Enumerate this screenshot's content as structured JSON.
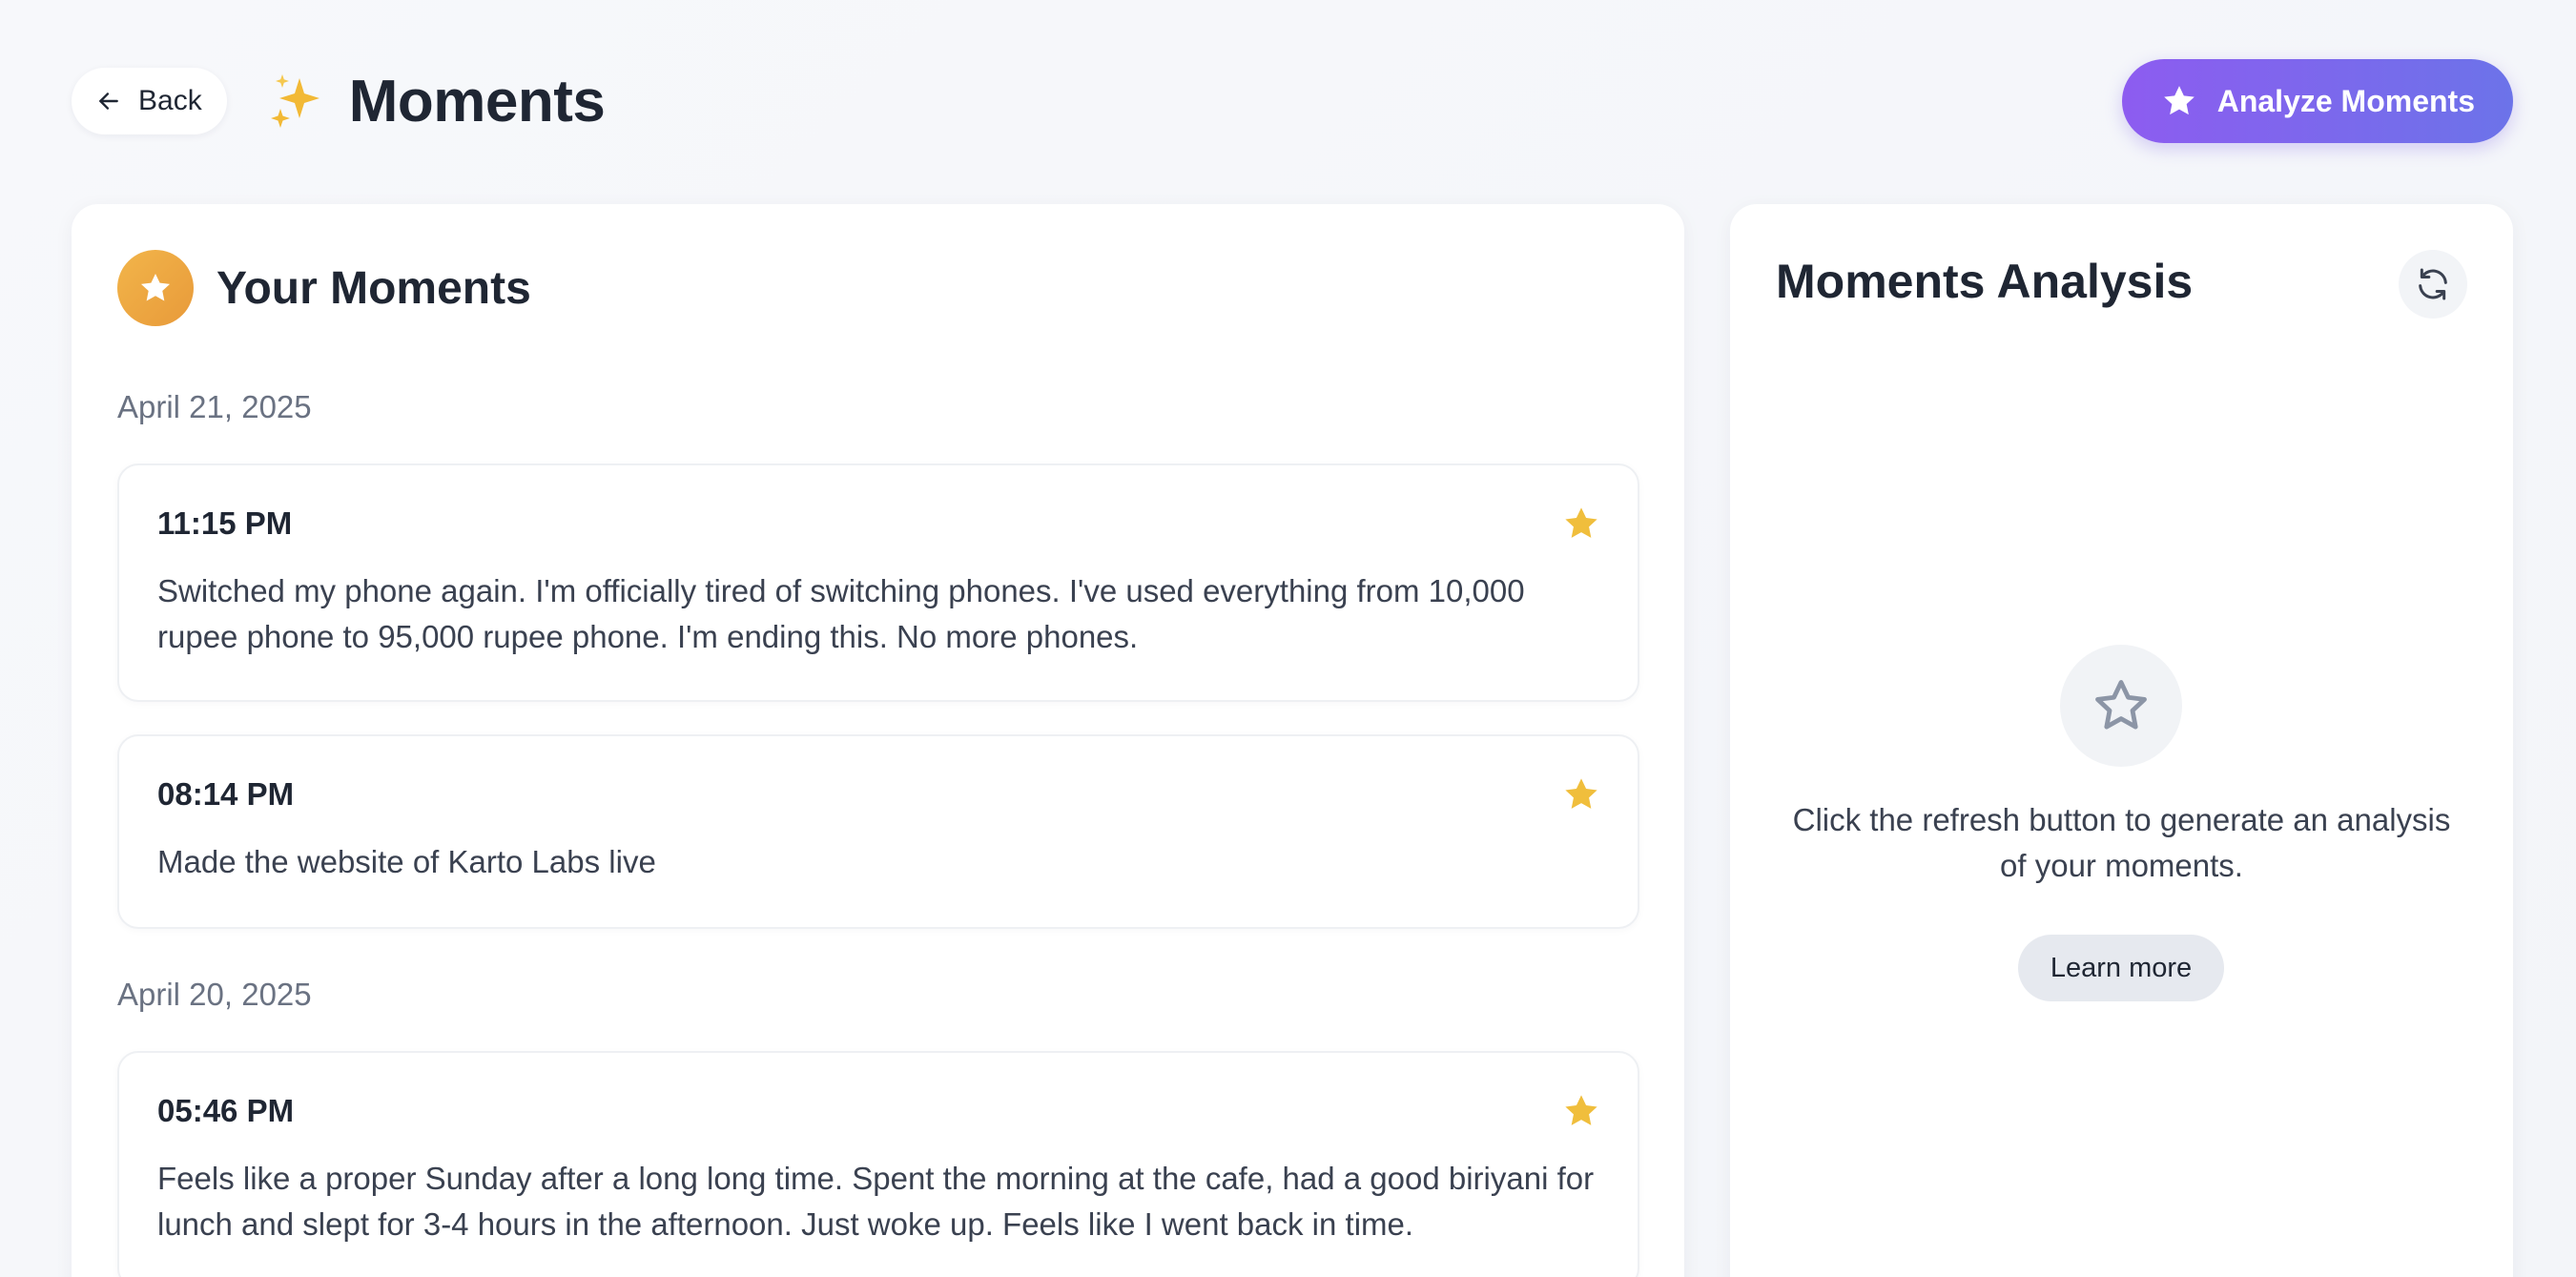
{
  "header": {
    "back_label": "Back",
    "title": "Moments",
    "analyze_label": "Analyze Moments"
  },
  "moments_panel": {
    "title": "Your Moments",
    "groups": [
      {
        "date": "April 21, 2025",
        "items": [
          {
            "time": "11:15 PM",
            "text": "Switched my phone again. I'm officially tired of switching phones. I've used everything from 10,000 rupee phone to 95,000 rupee phone. I'm ending this. No more phones.",
            "starred": true
          },
          {
            "time": "08:14 PM",
            "text": "Made the website of Karto Labs live",
            "starred": true
          }
        ]
      },
      {
        "date": "April 20, 2025",
        "items": [
          {
            "time": "05:46 PM",
            "text": "Feels like a proper Sunday after a long long time. Spent the morning at the cafe, had a good biriyani for lunch and slept for 3-4 hours in the afternoon. Just woke up. Feels like I went back in time.",
            "starred": true
          }
        ]
      }
    ]
  },
  "analysis_panel": {
    "title": "Moments Analysis",
    "empty_message": "Click the refresh button to generate an analysis of your moments.",
    "learn_more_label": "Learn more"
  },
  "colors": {
    "accent_gradient_start": "#8d5cf0",
    "accent_gradient_end": "#6c73e9",
    "star_gold": "#f0be3c",
    "badge_orange": "#ecaa44"
  },
  "icons": {
    "back": "arrow-left-icon",
    "title": "sparkles-icon",
    "analyze": "star-icon",
    "section": "star-icon",
    "moment": "star-filled-icon",
    "refresh": "refresh-icon",
    "empty": "star-outline-icon"
  }
}
